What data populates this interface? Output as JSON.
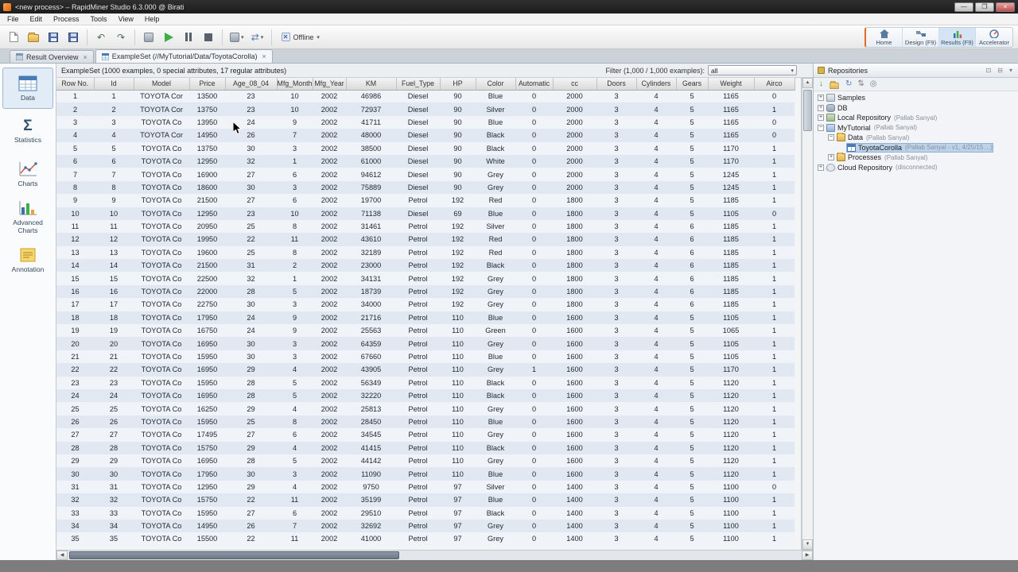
{
  "window": {
    "title": "<new process> – RapidMiner Studio 6.3.000 @ Birati",
    "menus": [
      "File",
      "Edit",
      "Process",
      "Tools",
      "View",
      "Help"
    ],
    "controls": {
      "minimize": "—",
      "maximize": "❐",
      "close": "×"
    }
  },
  "toolbar": {
    "offline_label": "Offline"
  },
  "perspectives": {
    "items": [
      {
        "label": "Home"
      },
      {
        "label": "Design (F9)"
      },
      {
        "label": "Results (F9)"
      },
      {
        "label": "Accelerator"
      }
    ]
  },
  "tabs": [
    {
      "label": "Result Overview"
    },
    {
      "label": "ExampleSet (//MyTutorial/Data/ToyotaCorolla)"
    }
  ],
  "sidebar": {
    "items": [
      "Data",
      "Statistics",
      "Charts",
      "Advanced Charts",
      "Annotation"
    ]
  },
  "main_header": {
    "title": "ExampleSet (1000 examples, 0 special attributes, 17 regular attributes)",
    "filter_label": "Filter (1,000 / 1,000 examples):",
    "filter_value": "all"
  },
  "table": {
    "columns": [
      "Row No.",
      "Id",
      "Model",
      "Price",
      "Age_08_04",
      "Mfg_Month",
      "Mfg_Year",
      "KM",
      "Fuel_Type",
      "HP",
      "Color",
      "Automatic",
      "cc",
      "Doors",
      "Cylinders",
      "Gears",
      "Weight",
      "Airco"
    ],
    "rows": [
      [
        1,
        1,
        "TOYOTA Cor",
        13500,
        23,
        10,
        2002,
        46986,
        "Diesel",
        90,
        "Blue",
        0,
        2000,
        3,
        4,
        5,
        1165,
        0
      ],
      [
        2,
        2,
        "TOYOTA Cor",
        13750,
        23,
        10,
        2002,
        72937,
        "Diesel",
        90,
        "Silver",
        0,
        2000,
        3,
        4,
        5,
        1165,
        1
      ],
      [
        3,
        3,
        "TOYOTA Co",
        13950,
        24,
        9,
        2002,
        41711,
        "Diesel",
        90,
        "Blue",
        0,
        2000,
        3,
        4,
        5,
        1165,
        0
      ],
      [
        4,
        4,
        "TOYOTA Cor",
        14950,
        26,
        7,
        2002,
        48000,
        "Diesel",
        90,
        "Black",
        0,
        2000,
        3,
        4,
        5,
        1165,
        0
      ],
      [
        5,
        5,
        "TOYOTA Co",
        13750,
        30,
        3,
        2002,
        38500,
        "Diesel",
        90,
        "Black",
        0,
        2000,
        3,
        4,
        5,
        1170,
        1
      ],
      [
        6,
        6,
        "TOYOTA Co",
        12950,
        32,
        1,
        2002,
        61000,
        "Diesel",
        90,
        "White",
        0,
        2000,
        3,
        4,
        5,
        1170,
        1
      ],
      [
        7,
        7,
        "TOYOTA Co",
        16900,
        27,
        6,
        2002,
        94612,
        "Diesel",
        90,
        "Grey",
        0,
        2000,
        3,
        4,
        5,
        1245,
        1
      ],
      [
        8,
        8,
        "TOYOTA Co",
        18600,
        30,
        3,
        2002,
        75889,
        "Diesel",
        90,
        "Grey",
        0,
        2000,
        3,
        4,
        5,
        1245,
        1
      ],
      [
        9,
        9,
        "TOYOTA Co",
        21500,
        27,
        6,
        2002,
        19700,
        "Petrol",
        192,
        "Red",
        0,
        1800,
        3,
        4,
        5,
        1185,
        1
      ],
      [
        10,
        10,
        "TOYOTA Co",
        12950,
        23,
        10,
        2002,
        71138,
        "Diesel",
        69,
        "Blue",
        0,
        1800,
        3,
        4,
        5,
        1105,
        0
      ],
      [
        11,
        11,
        "TOYOTA Co",
        20950,
        25,
        8,
        2002,
        31461,
        "Petrol",
        192,
        "Silver",
        0,
        1800,
        3,
        4,
        6,
        1185,
        1
      ],
      [
        12,
        12,
        "TOYOTA Co",
        19950,
        22,
        11,
        2002,
        43610,
        "Petrol",
        192,
        "Red",
        0,
        1800,
        3,
        4,
        6,
        1185,
        1
      ],
      [
        13,
        13,
        "TOYOTA Co",
        19600,
        25,
        8,
        2002,
        32189,
        "Petrol",
        192,
        "Red",
        0,
        1800,
        3,
        4,
        6,
        1185,
        1
      ],
      [
        14,
        14,
        "TOYOTA Co",
        21500,
        31,
        2,
        2002,
        23000,
        "Petrol",
        192,
        "Black",
        0,
        1800,
        3,
        4,
        6,
        1185,
        1
      ],
      [
        15,
        15,
        "TOYOTA Co",
        22500,
        32,
        1,
        2002,
        34131,
        "Petrol",
        192,
        "Grey",
        0,
        1800,
        3,
        4,
        6,
        1185,
        1
      ],
      [
        16,
        16,
        "TOYOTA Co",
        22000,
        28,
        5,
        2002,
        18739,
        "Petrol",
        192,
        "Grey",
        0,
        1800,
        3,
        4,
        6,
        1185,
        1
      ],
      [
        17,
        17,
        "TOYOTA Co",
        22750,
        30,
        3,
        2002,
        34000,
        "Petrol",
        192,
        "Grey",
        0,
        1800,
        3,
        4,
        6,
        1185,
        1
      ],
      [
        18,
        18,
        "TOYOTA Co",
        17950,
        24,
        9,
        2002,
        21716,
        "Petrol",
        110,
        "Blue",
        0,
        1600,
        3,
        4,
        5,
        1105,
        1
      ],
      [
        19,
        19,
        "TOYOTA Co",
        16750,
        24,
        9,
        2002,
        25563,
        "Petrol",
        110,
        "Green",
        0,
        1600,
        3,
        4,
        5,
        1065,
        1
      ],
      [
        20,
        20,
        "TOYOTA Co",
        16950,
        30,
        3,
        2002,
        64359,
        "Petrol",
        110,
        "Grey",
        0,
        1600,
        3,
        4,
        5,
        1105,
        1
      ],
      [
        21,
        21,
        "TOYOTA Co",
        15950,
        30,
        3,
        2002,
        67660,
        "Petrol",
        110,
        "Blue",
        0,
        1600,
        3,
        4,
        5,
        1105,
        1
      ],
      [
        22,
        22,
        "TOYOTA Co",
        16950,
        29,
        4,
        2002,
        43905,
        "Petrol",
        110,
        "Grey",
        1,
        1600,
        3,
        4,
        5,
        1170,
        1
      ],
      [
        23,
        23,
        "TOYOTA Co",
        15950,
        28,
        5,
        2002,
        56349,
        "Petrol",
        110,
        "Black",
        0,
        1600,
        3,
        4,
        5,
        1120,
        1
      ],
      [
        24,
        24,
        "TOYOTA Co",
        16950,
        28,
        5,
        2002,
        32220,
        "Petrol",
        110,
        "Black",
        0,
        1600,
        3,
        4,
        5,
        1120,
        1
      ],
      [
        25,
        25,
        "TOYOTA Co",
        16250,
        29,
        4,
        2002,
        25813,
        "Petrol",
        110,
        "Grey",
        0,
        1600,
        3,
        4,
        5,
        1120,
        1
      ],
      [
        26,
        26,
        "TOYOTA Co",
        15950,
        25,
        8,
        2002,
        28450,
        "Petrol",
        110,
        "Blue",
        0,
        1600,
        3,
        4,
        5,
        1120,
        1
      ],
      [
        27,
        27,
        "TOYOTA Co",
        17495,
        27,
        6,
        2002,
        34545,
        "Petrol",
        110,
        "Grey",
        0,
        1600,
        3,
        4,
        5,
        1120,
        1
      ],
      [
        28,
        28,
        "TOYOTA Co",
        15750,
        29,
        4,
        2002,
        41415,
        "Petrol",
        110,
        "Black",
        0,
        1600,
        3,
        4,
        5,
        1120,
        1
      ],
      [
        29,
        29,
        "TOYOTA Co",
        16950,
        28,
        5,
        2002,
        44142,
        "Petrol",
        110,
        "Grey",
        0,
        1600,
        3,
        4,
        5,
        1120,
        1
      ],
      [
        30,
        30,
        "TOYOTA Co",
        17950,
        30,
        3,
        2002,
        11090,
        "Petrol",
        110,
        "Blue",
        0,
        1600,
        3,
        4,
        5,
        1120,
        1
      ],
      [
        31,
        31,
        "TOYOTA Co",
        12950,
        29,
        4,
        2002,
        9750,
        "Petrol",
        97,
        "Silver",
        0,
        1400,
        3,
        4,
        5,
        1100,
        0
      ],
      [
        32,
        32,
        "TOYOTA Co",
        15750,
        22,
        11,
        2002,
        35199,
        "Petrol",
        97,
        "Blue",
        0,
        1400,
        3,
        4,
        5,
        1100,
        1
      ],
      [
        33,
        33,
        "TOYOTA Co",
        15950,
        27,
        6,
        2002,
        29510,
        "Petrol",
        97,
        "Black",
        0,
        1400,
        3,
        4,
        5,
        1100,
        1
      ],
      [
        34,
        34,
        "TOYOTA Co",
        14950,
        26,
        7,
        2002,
        32692,
        "Petrol",
        97,
        "Grey",
        0,
        1400,
        3,
        4,
        5,
        1100,
        1
      ],
      [
        35,
        35,
        "TOYOTA Co",
        15500,
        22,
        11,
        2002,
        41000,
        "Petrol",
        97,
        "Grey",
        0,
        1400,
        3,
        4,
        5,
        1100,
        1
      ]
    ]
  },
  "repositories": {
    "tab_label": "Repositories",
    "items": [
      {
        "label": "Samples",
        "meta": "",
        "level": 0,
        "expanded": false,
        "icon": "samples"
      },
      {
        "label": "DB",
        "meta": "",
        "level": 0,
        "expanded": false,
        "icon": "db"
      },
      {
        "label": "Local Repository",
        "meta": "(Pallab Sanyal)",
        "level": 0,
        "expanded": false,
        "icon": "local"
      },
      {
        "label": "MyTutorial",
        "meta": "(Pallab Sanyal)",
        "level": 0,
        "expanded": true,
        "icon": "repo"
      },
      {
        "label": "Data",
        "meta": "(Pallab Sanyal)",
        "level": 1,
        "expanded": true,
        "icon": "folder"
      },
      {
        "label": "ToyotaCorolla",
        "meta": "(Pallab Sanyal - v1, 4/25/15 ...)",
        "level": 2,
        "expanded": null,
        "icon": "table",
        "selected": true
      },
      {
        "label": "Processes",
        "meta": "(Pallab Sanyal)",
        "level": 1,
        "expanded": false,
        "icon": "folder"
      },
      {
        "label": "Cloud Repository",
        "meta": "(disconnected)",
        "level": 0,
        "expanded": false,
        "icon": "cloud"
      }
    ]
  },
  "colors": {
    "accent_orange": "#e06a2b",
    "play_green": "#3fae49",
    "selection_blue": "#bdd3ea",
    "row_odd": "#f0f3f8",
    "row_even": "#e2e8f1"
  }
}
